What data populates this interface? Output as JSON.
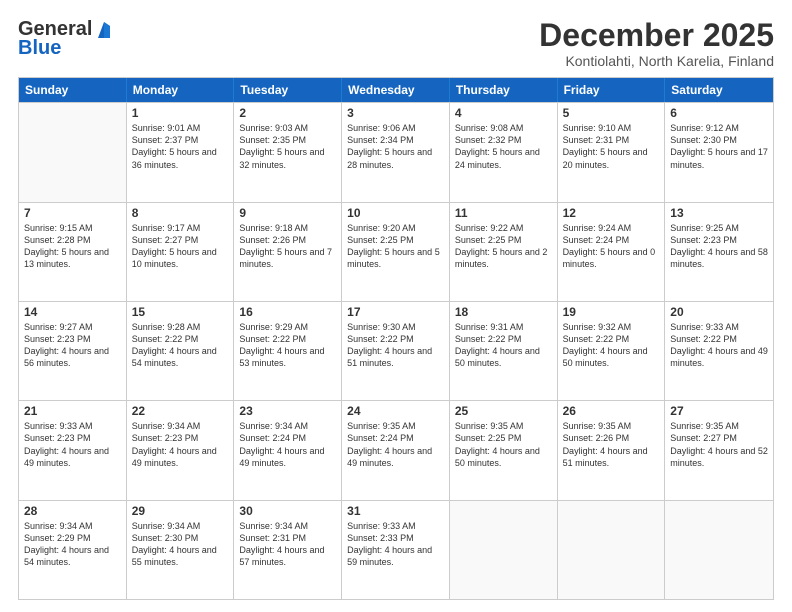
{
  "logo": {
    "line1": "General",
    "line2": "Blue"
  },
  "header": {
    "title": "December 2025",
    "location": "Kontiolahti, North Karelia, Finland"
  },
  "weekdays": [
    "Sunday",
    "Monday",
    "Tuesday",
    "Wednesday",
    "Thursday",
    "Friday",
    "Saturday"
  ],
  "weeks": [
    [
      {
        "day": "",
        "sunrise": "",
        "sunset": "",
        "daylight": ""
      },
      {
        "day": "1",
        "sunrise": "Sunrise: 9:01 AM",
        "sunset": "Sunset: 2:37 PM",
        "daylight": "Daylight: 5 hours and 36 minutes."
      },
      {
        "day": "2",
        "sunrise": "Sunrise: 9:03 AM",
        "sunset": "Sunset: 2:35 PM",
        "daylight": "Daylight: 5 hours and 32 minutes."
      },
      {
        "day": "3",
        "sunrise": "Sunrise: 9:06 AM",
        "sunset": "Sunset: 2:34 PM",
        "daylight": "Daylight: 5 hours and 28 minutes."
      },
      {
        "day": "4",
        "sunrise": "Sunrise: 9:08 AM",
        "sunset": "Sunset: 2:32 PM",
        "daylight": "Daylight: 5 hours and 24 minutes."
      },
      {
        "day": "5",
        "sunrise": "Sunrise: 9:10 AM",
        "sunset": "Sunset: 2:31 PM",
        "daylight": "Daylight: 5 hours and 20 minutes."
      },
      {
        "day": "6",
        "sunrise": "Sunrise: 9:12 AM",
        "sunset": "Sunset: 2:30 PM",
        "daylight": "Daylight: 5 hours and 17 minutes."
      }
    ],
    [
      {
        "day": "7",
        "sunrise": "Sunrise: 9:15 AM",
        "sunset": "Sunset: 2:28 PM",
        "daylight": "Daylight: 5 hours and 13 minutes."
      },
      {
        "day": "8",
        "sunrise": "Sunrise: 9:17 AM",
        "sunset": "Sunset: 2:27 PM",
        "daylight": "Daylight: 5 hours and 10 minutes."
      },
      {
        "day": "9",
        "sunrise": "Sunrise: 9:18 AM",
        "sunset": "Sunset: 2:26 PM",
        "daylight": "Daylight: 5 hours and 7 minutes."
      },
      {
        "day": "10",
        "sunrise": "Sunrise: 9:20 AM",
        "sunset": "Sunset: 2:25 PM",
        "daylight": "Daylight: 5 hours and 5 minutes."
      },
      {
        "day": "11",
        "sunrise": "Sunrise: 9:22 AM",
        "sunset": "Sunset: 2:25 PM",
        "daylight": "Daylight: 5 hours and 2 minutes."
      },
      {
        "day": "12",
        "sunrise": "Sunrise: 9:24 AM",
        "sunset": "Sunset: 2:24 PM",
        "daylight": "Daylight: 5 hours and 0 minutes."
      },
      {
        "day": "13",
        "sunrise": "Sunrise: 9:25 AM",
        "sunset": "Sunset: 2:23 PM",
        "daylight": "Daylight: 4 hours and 58 minutes."
      }
    ],
    [
      {
        "day": "14",
        "sunrise": "Sunrise: 9:27 AM",
        "sunset": "Sunset: 2:23 PM",
        "daylight": "Daylight: 4 hours and 56 minutes."
      },
      {
        "day": "15",
        "sunrise": "Sunrise: 9:28 AM",
        "sunset": "Sunset: 2:22 PM",
        "daylight": "Daylight: 4 hours and 54 minutes."
      },
      {
        "day": "16",
        "sunrise": "Sunrise: 9:29 AM",
        "sunset": "Sunset: 2:22 PM",
        "daylight": "Daylight: 4 hours and 53 minutes."
      },
      {
        "day": "17",
        "sunrise": "Sunrise: 9:30 AM",
        "sunset": "Sunset: 2:22 PM",
        "daylight": "Daylight: 4 hours and 51 minutes."
      },
      {
        "day": "18",
        "sunrise": "Sunrise: 9:31 AM",
        "sunset": "Sunset: 2:22 PM",
        "daylight": "Daylight: 4 hours and 50 minutes."
      },
      {
        "day": "19",
        "sunrise": "Sunrise: 9:32 AM",
        "sunset": "Sunset: 2:22 PM",
        "daylight": "Daylight: 4 hours and 50 minutes."
      },
      {
        "day": "20",
        "sunrise": "Sunrise: 9:33 AM",
        "sunset": "Sunset: 2:22 PM",
        "daylight": "Daylight: 4 hours and 49 minutes."
      }
    ],
    [
      {
        "day": "21",
        "sunrise": "Sunrise: 9:33 AM",
        "sunset": "Sunset: 2:23 PM",
        "daylight": "Daylight: 4 hours and 49 minutes."
      },
      {
        "day": "22",
        "sunrise": "Sunrise: 9:34 AM",
        "sunset": "Sunset: 2:23 PM",
        "daylight": "Daylight: 4 hours and 49 minutes."
      },
      {
        "day": "23",
        "sunrise": "Sunrise: 9:34 AM",
        "sunset": "Sunset: 2:24 PM",
        "daylight": "Daylight: 4 hours and 49 minutes."
      },
      {
        "day": "24",
        "sunrise": "Sunrise: 9:35 AM",
        "sunset": "Sunset: 2:24 PM",
        "daylight": "Daylight: 4 hours and 49 minutes."
      },
      {
        "day": "25",
        "sunrise": "Sunrise: 9:35 AM",
        "sunset": "Sunset: 2:25 PM",
        "daylight": "Daylight: 4 hours and 50 minutes."
      },
      {
        "day": "26",
        "sunrise": "Sunrise: 9:35 AM",
        "sunset": "Sunset: 2:26 PM",
        "daylight": "Daylight: 4 hours and 51 minutes."
      },
      {
        "day": "27",
        "sunrise": "Sunrise: 9:35 AM",
        "sunset": "Sunset: 2:27 PM",
        "daylight": "Daylight: 4 hours and 52 minutes."
      }
    ],
    [
      {
        "day": "28",
        "sunrise": "Sunrise: 9:34 AM",
        "sunset": "Sunset: 2:29 PM",
        "daylight": "Daylight: 4 hours and 54 minutes."
      },
      {
        "day": "29",
        "sunrise": "Sunrise: 9:34 AM",
        "sunset": "Sunset: 2:30 PM",
        "daylight": "Daylight: 4 hours and 55 minutes."
      },
      {
        "day": "30",
        "sunrise": "Sunrise: 9:34 AM",
        "sunset": "Sunset: 2:31 PM",
        "daylight": "Daylight: 4 hours and 57 minutes."
      },
      {
        "day": "31",
        "sunrise": "Sunrise: 9:33 AM",
        "sunset": "Sunset: 2:33 PM",
        "daylight": "Daylight: 4 hours and 59 minutes."
      },
      {
        "day": "",
        "sunrise": "",
        "sunset": "",
        "daylight": ""
      },
      {
        "day": "",
        "sunrise": "",
        "sunset": "",
        "daylight": ""
      },
      {
        "day": "",
        "sunrise": "",
        "sunset": "",
        "daylight": ""
      }
    ]
  ]
}
